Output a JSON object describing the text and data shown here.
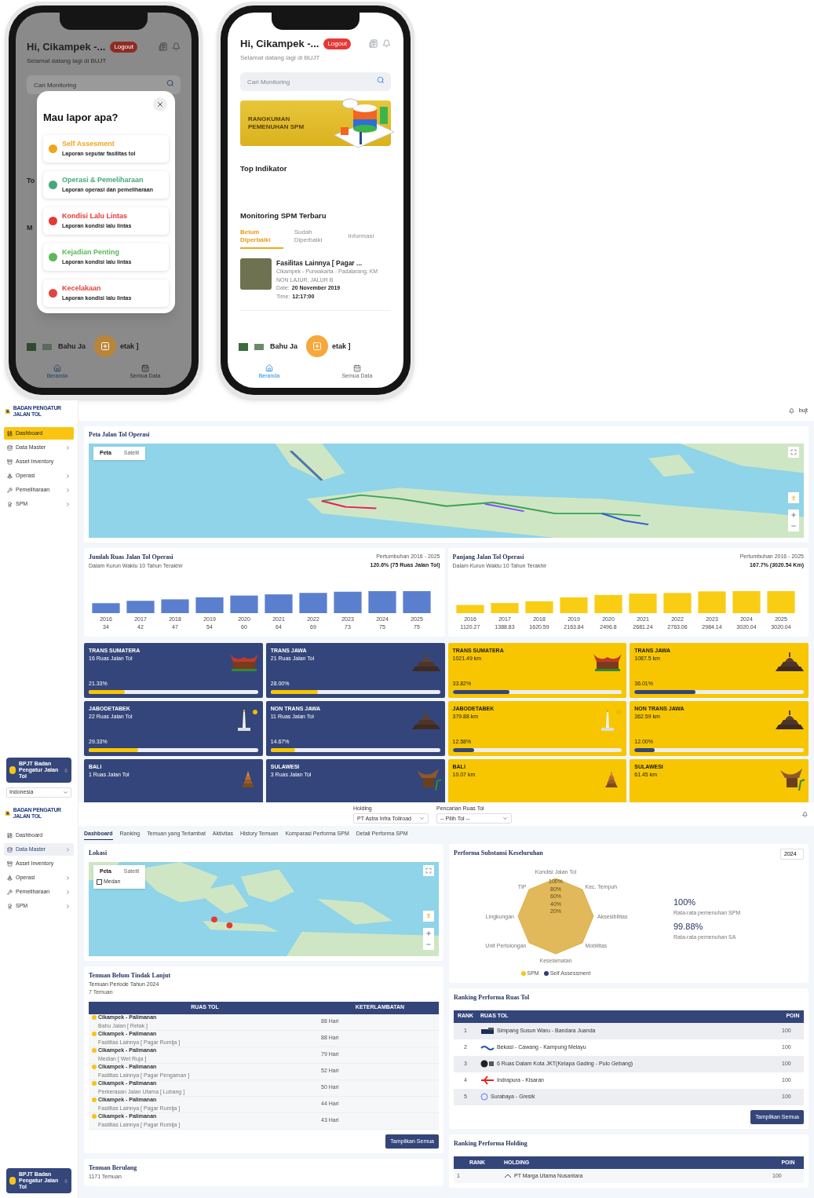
{
  "phones": [
    {
      "kind": "report_menu",
      "greeting": "Hi, Cikampek -...",
      "logout": "Logout",
      "subtitle": "Selamat datang lagi di BUJT",
      "search_placeholder": "Cari Monitoring",
      "peek_texts": [
        "To",
        "M"
      ],
      "modal": {
        "title": "Mau lapor apa?",
        "items": [
          {
            "title": "Self Assesment",
            "subtitle": "Laporan seputar fasilitas tol",
            "color": "#f2a51a"
          },
          {
            "title": "Operasi & Pemeliharaan",
            "subtitle": "Laporan operasi dan pemeliharaan",
            "color": "#43a87a"
          },
          {
            "title": "Kondisi Lalu Lintas",
            "subtitle": "Laporan kondisi lalu lintas",
            "color": "#e53935"
          },
          {
            "title": "Kejadian Penting",
            "subtitle": "Laporan kondisi lalu lintas",
            "color": "#5cb85c"
          },
          {
            "title": "Kecelakaan",
            "subtitle": "Laporan kondisi lalu lintas",
            "color": "#e0453f"
          }
        ]
      },
      "list_item": {
        "before": "Bahu Ja",
        "after": "etak ]"
      },
      "nav": [
        {
          "label": "Beranda",
          "selected": true
        },
        {
          "label": "Semua Data",
          "selected": false
        }
      ]
    },
    {
      "kind": "home",
      "greeting": "Hi, Cikampek -...",
      "logout": "Logout",
      "subtitle": "Selamat datang lagi di BUJT",
      "search_placeholder": "Cari Monitoring",
      "banner": "RANGKUMAN PEMENUHAN SPM",
      "top_title": "Top Indikator",
      "monitor_title": "Monitoring SPM Terbaru",
      "tabs": [
        {
          "label": "Belum Diperbaiki",
          "selected": true
        },
        {
          "label": "Sudah Diperbaiki",
          "selected": false
        },
        {
          "label": "Informasi",
          "selected": false
        }
      ],
      "finding": {
        "title": "Fasilitas Lainnya [ Pagar ...",
        "location": "Cikampek - Purwakarta - Padalarang, KM",
        "lane": "NON LAJUR, JALUR B",
        "date_label": "Date:",
        "date": "20 November 2019",
        "time_label": "Time:",
        "time": "12:17:00"
      },
      "list_item": {
        "before": "Bahu Ja",
        "after": "etak ]"
      },
      "nav": [
        {
          "label": "Beranda",
          "selected": true
        },
        {
          "label": "Semua Data",
          "selected": false
        }
      ]
    }
  ],
  "dashboards": [
    {
      "kind": "overview",
      "logo": "BADAN PENGATUR JALAN TOL",
      "user": "bujt",
      "menu": [
        {
          "label": "Dashboard",
          "selected": true,
          "submenu": false,
          "kind": "dashboard"
        },
        {
          "label": "Data Master",
          "selected": false,
          "submenu": true,
          "kind": "database"
        },
        {
          "label": "Asset Inventory",
          "selected": false,
          "submenu": false,
          "kind": "inventory"
        },
        {
          "label": "Operasi",
          "selected": false,
          "submenu": true,
          "kind": "operation"
        },
        {
          "label": "Pemeliharaan",
          "selected": false,
          "submenu": true,
          "kind": "maintenance"
        },
        {
          "label": "SPM",
          "selected": false,
          "submenu": true,
          "kind": "spm"
        }
      ],
      "org_card": "BPJT Badan Pengatur Jalan Tol",
      "region_select": "Indonesia",
      "map_card": {
        "title": "Peta Jalan Tol Operasi",
        "map_types": [
          {
            "label": "Peta",
            "selected": true
          },
          {
            "label": "Satelit",
            "selected": false
          }
        ]
      },
      "panels": [
        {
          "kind": "count",
          "title": "Jumlah Ruas Jalan Tol Operasi",
          "subtitle": "Dalam Kurun Waktu 10 Tahun Terakhir",
          "growth_label": "Pertumbuhan 2016 - 2025",
          "growth_value": "120.6% (75 Ruas Jalan Tol)",
          "chart_data": {
            "type": "bar",
            "categories": [
              "2016",
              "2017",
              "2018",
              "2019",
              "2020",
              "2021",
              "2022",
              "2023",
              "2024",
              "2025"
            ],
            "values": [
              34,
              42,
              47,
              54,
              60,
              64,
              69,
              73,
              75,
              75
            ],
            "data_labels": true
          },
          "cards": [
            {
              "name": "TRANS SUMATERA",
              "detail": "16 Ruas Jalan Tol",
              "percent": "21.33%",
              "level": 0.2133,
              "kind": "rumah-gadang"
            },
            {
              "name": "TRANS JAWA",
              "detail": "21 Ruas Jalan Tol",
              "percent": "28.00%",
              "level": 0.28,
              "kind": "stupa"
            },
            {
              "name": "JABODETABEK",
              "detail": "22 Ruas Jalan Tol",
              "percent": "29.33%",
              "level": 0.2933,
              "kind": "monument"
            },
            {
              "name": "NON TRANS JAWA",
              "detail": "11 Ruas Jalan Tol",
              "percent": "14.67%",
              "level": 0.1467,
              "kind": "stupa"
            },
            {
              "name": "BALI",
              "detail": "1 Ruas Jalan Tol",
              "kind": "meru"
            },
            {
              "name": "SULAWESI",
              "detail": "3 Ruas Jalan Tol",
              "kind": "tongkonan"
            }
          ]
        },
        {
          "kind": "length",
          "title": "Panjang Jalan Tol Operasi",
          "subtitle": "Dalam Kurun Waktu 10 Tahun Terakhir",
          "growth_label": "Pertumbuhan 2016 - 2025",
          "growth_value": "167.7% (3020.54 Km)",
          "chart_data": {
            "type": "bar",
            "categories": [
              "2016",
              "2017",
              "2018",
              "2019",
              "2020",
              "2021",
              "2022",
              "2023",
              "2024",
              "2025"
            ],
            "values": [
              1120.27,
              1388.83,
              1620.59,
              2163.84,
              2496.8,
              2681.24,
              2763.06,
              2984.14,
              3020.04,
              3020.04
            ],
            "data_labels": true
          },
          "cards": [
            {
              "name": "TRANS SUMATERA",
              "detail": "1021.49 km",
              "percent": "33.82%",
              "level": 0.3382,
              "kind": "rumah-gadang"
            },
            {
              "name": "TRANS JAWA",
              "detail": "1087.5 km",
              "percent": "36.01%",
              "level": 0.3601,
              "kind": "stupa"
            },
            {
              "name": "JABODETABEK",
              "detail": "379.88 km",
              "percent": "12.58%",
              "level": 0.1258,
              "kind": "monument"
            },
            {
              "name": "NON TRANS JAWA",
              "detail": "362.59 km",
              "percent": "12.00%",
              "level": 0.12,
              "kind": "stupa"
            },
            {
              "name": "BALI",
              "detail": "10.07 km",
              "kind": "meru"
            },
            {
              "name": "SULAWESI",
              "detail": "61.45 km",
              "kind": "tongkonan"
            }
          ]
        }
      ]
    },
    {
      "kind": "spm",
      "logo": "BADAN PENGATUR JALAN TOL",
      "filters": [
        {
          "label": "Holding",
          "value": "PT Astra Infra Tollroad"
        },
        {
          "label": "Pencarian Ruas Tol",
          "value": "-- Pilih Tol --"
        }
      ],
      "menu": [
        {
          "label": "Dashboard",
          "selected": false,
          "submenu": false,
          "kind": "dashboard"
        },
        {
          "label": "Data Master",
          "selected": true,
          "submenu": true,
          "kind": "database"
        },
        {
          "label": "Asset Inventory",
          "selected": false,
          "submenu": false,
          "kind": "inventory"
        },
        {
          "label": "Operasi",
          "selected": false,
          "submenu": true,
          "kind": "operation"
        },
        {
          "label": "Pemeliharaan",
          "selected": false,
          "submenu": true,
          "kind": "maintenance"
        },
        {
          "label": "SPM",
          "selected": false,
          "submenu": true,
          "kind": "spm"
        }
      ],
      "org_card": "BPJT Badan Pengatur Jalan Tol",
      "tabs": [
        {
          "label": "Dashboard",
          "selected": true
        },
        {
          "label": "Ranking",
          "selected": false
        },
        {
          "label": "Temuan yang Terlambat",
          "selected": false
        },
        {
          "label": "Aktivitas",
          "selected": false
        },
        {
          "label": "History Temuan",
          "selected": false
        },
        {
          "label": "Komparasi Performa SPM",
          "selected": false
        },
        {
          "label": "Detail Performa SPM",
          "selected": false
        }
      ],
      "location_card": {
        "title": "Lokasi",
        "map_types": [
          {
            "label": "Peta",
            "selected": true
          },
          {
            "label": "Satelit",
            "selected": false
          }
        ],
        "terrain": {
          "label": "Medan",
          "checked": false
        }
      },
      "findings_card": {
        "title": "Temuan Belum Tindak Lanjut",
        "period": "Temuan Periode Tahun 2024",
        "count": "7 Temuan",
        "columns": [
          "RUAS TOL",
          "KETERLAMBATAN"
        ],
        "rows": [
          {
            "ruas": "Cikampek - Palimanan",
            "item": "Bahu Jalan [ Retak ]",
            "delay": "88 Hari"
          },
          {
            "ruas": "Cikampek - Palimanan",
            "item": "Fasilitas Lainnya [ Pagar Rumija ]",
            "delay": "88 Hari"
          },
          {
            "ruas": "Cikampek - Palimanan",
            "item": "Median [ Wet Ruja ]",
            "delay": "79 Hari"
          },
          {
            "ruas": "Cikampek - Palimanan",
            "item": "Fasilitas Lainnya [ Pagar Pengaman ]",
            "delay": "52 Hari"
          },
          {
            "ruas": "Cikampek - Palimanan",
            "item": "Perkerasan Jalan Utama [ Lubang ]",
            "delay": "50 Hari"
          },
          {
            "ruas": "Cikampek - Palimanan",
            "item": "Fasilitas Lainnya [ Pagar Rumija ]",
            "delay": "44 Hari"
          },
          {
            "ruas": "Cikampek - Palimanan",
            "item": "Fasilitas Lainnya [ Pagar Rumija ]",
            "delay": "43 Hari"
          }
        ],
        "button": "Tampilkan Semua"
      },
      "repeat_card": {
        "title": "Temuan Berulang",
        "count": "1171 Temuan"
      },
      "performance_card": {
        "title": "Performa Substansi Keseluruhan",
        "year": "2024",
        "axes": [
          "Kondisi Jalan Tol",
          "TIP",
          "Kec. Tempuh",
          "Lingkungan",
          "Aksesibilitas",
          "Unit Pertolongan",
          "Mobilitas",
          "Keselamatan"
        ],
        "ticks": [
          "100%",
          "80%",
          "60%",
          "40%",
          "20%"
        ],
        "legend": [
          {
            "label": "SPM",
            "color": "#f5c518"
          },
          {
            "label": "Self Assessment",
            "color": "#2f3e75"
          }
        ],
        "stats": [
          {
            "value": "100%",
            "label": "Rata-rata pemenuhan SPM"
          },
          {
            "value": "99.88%",
            "label": "Rata-rata pemenuhan SA"
          }
        ]
      },
      "ranking_card": {
        "title": "Ranking Performa Ruas Tol",
        "columns": [
          "RANK",
          "RUAS TOL",
          "POIN"
        ],
        "rows": [
          {
            "rank": "1",
            "name": "Simpang Susun Waru - Bandara Juanda",
            "points": "100",
            "kind": "truck"
          },
          {
            "rank": "2",
            "name": "Bekasi - Cawang - Kampung Melayu",
            "points": "100",
            "kind": "wave"
          },
          {
            "rank": "3",
            "name": "6 Ruas Dalam Kota JKT(Kelapa Gading - Pulo Gebang)",
            "points": "100",
            "kind": "badge"
          },
          {
            "rank": "4",
            "name": "Indrapura - Kisaran",
            "points": "100",
            "kind": "cross"
          },
          {
            "rank": "5",
            "name": "Surabaya - Gresik",
            "points": "100",
            "kind": "circle"
          }
        ],
        "button": "Tampilkan Semua"
      },
      "holding_card": {
        "title": "Ranking Performa Holding",
        "columns": [
          "RANK",
          "HOLDING",
          "POIN"
        ],
        "rows": [
          {
            "rank": "1",
            "name": "PT Marga Utama Nusantara",
            "points": "100"
          }
        ]
      }
    }
  ]
}
